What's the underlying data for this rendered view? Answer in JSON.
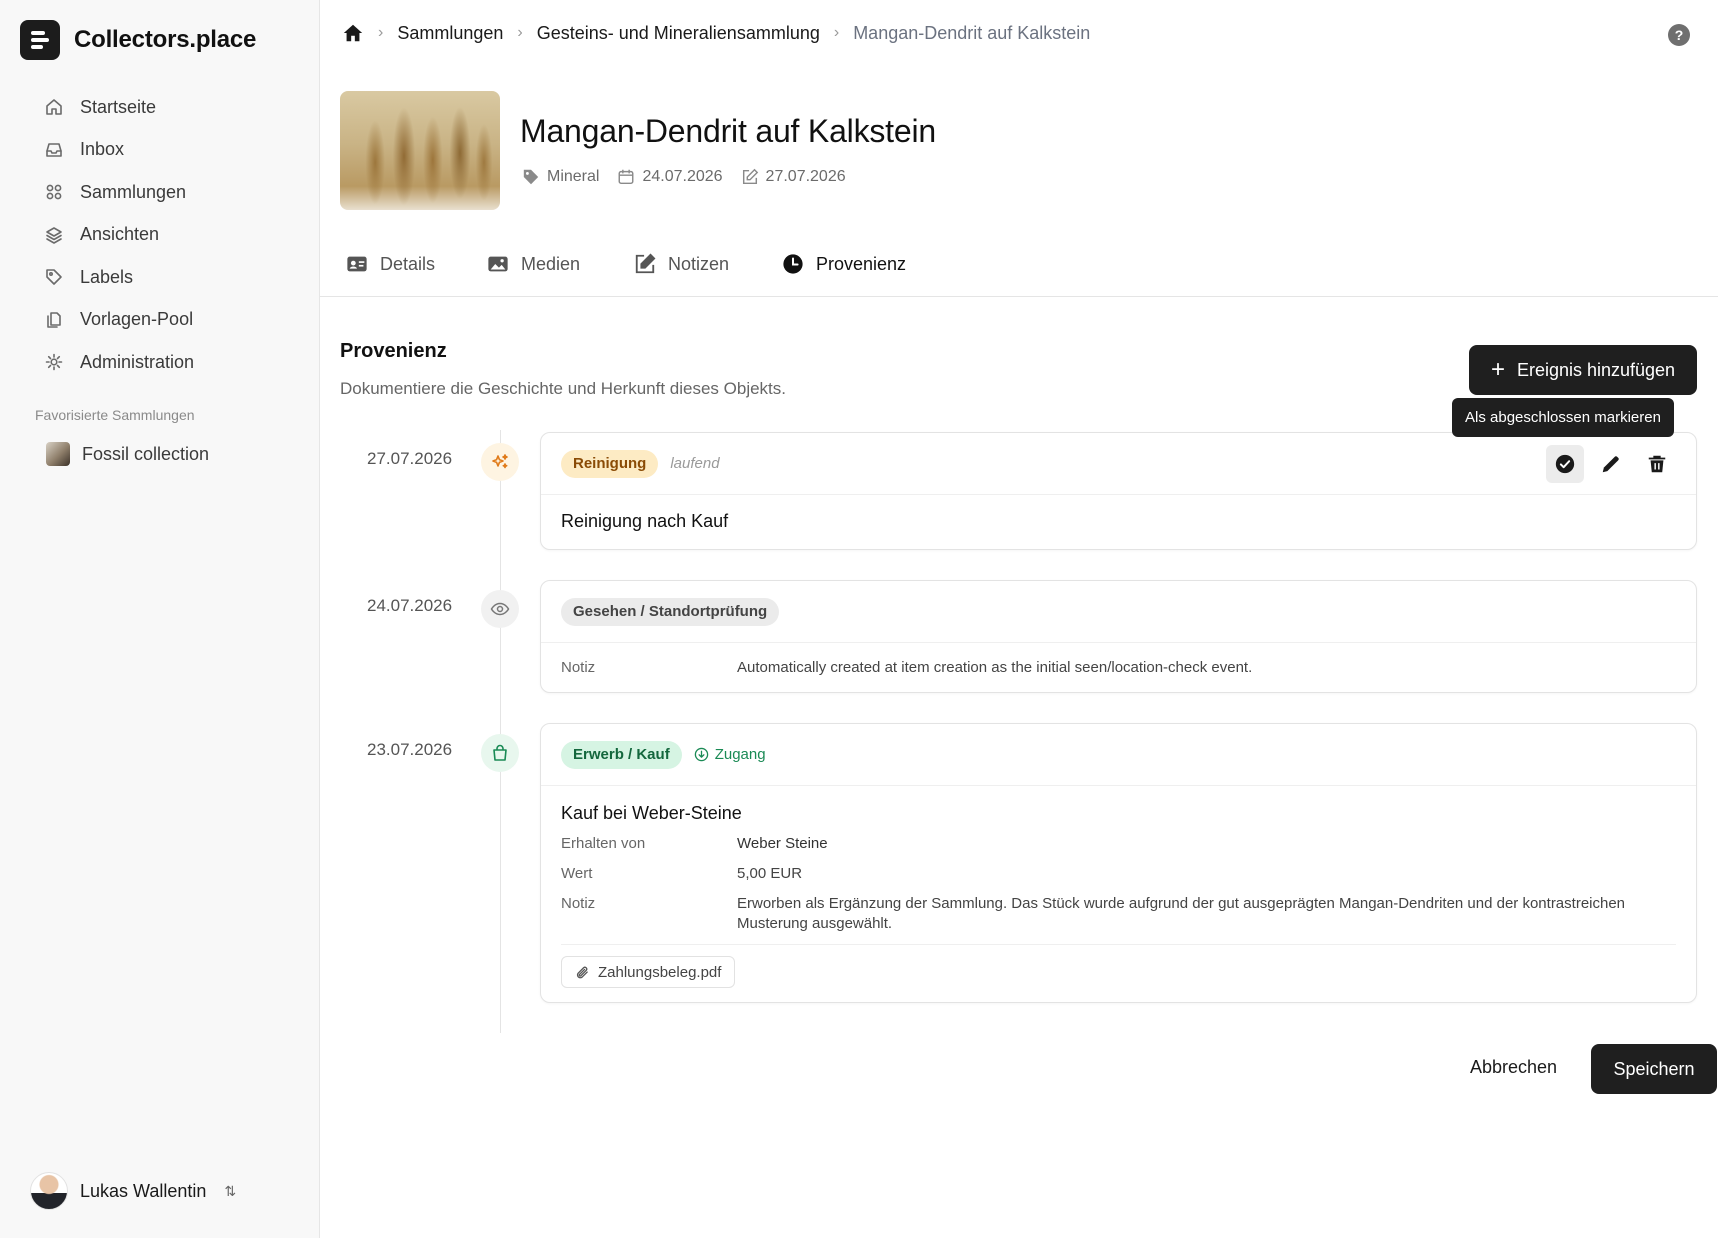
{
  "app": {
    "name": "Collectors.place"
  },
  "sidebar": {
    "items": [
      {
        "label": "Startseite",
        "icon": "home-icon"
      },
      {
        "label": "Inbox",
        "icon": "inbox-icon"
      },
      {
        "label": "Sammlungen",
        "icon": "grid-icon"
      },
      {
        "label": "Ansichten",
        "icon": "layers-icon"
      },
      {
        "label": "Labels",
        "icon": "tag-icon"
      },
      {
        "label": "Vorlagen-Pool",
        "icon": "copy-icon"
      },
      {
        "label": "Administration",
        "icon": "gear-icon"
      }
    ],
    "favorites_label": "Favorisierte Sammlungen",
    "favorites": [
      {
        "label": "Fossil collection"
      }
    ],
    "user": {
      "name": "Lukas Wallentin"
    }
  },
  "breadcrumb": {
    "items": [
      "Sammlungen",
      "Gesteins- und Mineraliensammlung"
    ],
    "current": "Mangan-Dendrit auf Kalkstein"
  },
  "item": {
    "title": "Mangan-Dendrit auf Kalkstein",
    "type": "Mineral",
    "created": "24.07.2026",
    "edited": "27.07.2026"
  },
  "tabs": [
    {
      "label": "Details",
      "icon": "id-card-icon"
    },
    {
      "label": "Medien",
      "icon": "image-icon"
    },
    {
      "label": "Notizen",
      "icon": "edit-icon"
    },
    {
      "label": "Provenienz",
      "icon": "clock-icon",
      "active": true
    }
  ],
  "provenance": {
    "title": "Provenienz",
    "subtitle": "Dokumentiere die Geschichte und Herkunft dieses Objekts.",
    "add_label": "Ereignis hinzufügen",
    "tooltip": "Als abgeschlossen markieren",
    "events": [
      {
        "date": "27.07.2026",
        "type": "Reinigung",
        "status": "laufend",
        "text": "Reinigung nach Kauf",
        "colors": {
          "badge_bg": "#fdebc4",
          "badge_fg": "#8a4b06",
          "dot_bg": "#fef4e2"
        }
      },
      {
        "date": "24.07.2026",
        "type": "Gesehen / Standortprüfung",
        "note_label": "Notiz",
        "note": "Automatically created at item creation as the initial seen/location-check event."
      },
      {
        "date": "23.07.2026",
        "type": "Erwerb / Kauf",
        "direction": "Zugang",
        "text": "Kauf bei Weber-Steine",
        "fields": [
          {
            "label": "Erhalten von",
            "value": "Weber Steine"
          },
          {
            "label": "Wert",
            "value": "5,00 EUR"
          },
          {
            "label": "Notiz",
            "value": "Erworben als Ergänzung der Sammlung. Das Stück wurde aufgrund der gut ausgeprägten Mangan-Dendriten und der kontrastreichen Musterung ausgewählt."
          }
        ],
        "attachment": "Zahlungsbeleg.pdf"
      }
    ]
  },
  "footer": {
    "cancel_label": "Abbrechen",
    "save_label": "Speichern"
  },
  "colors": {
    "primary": "#1f1f1f",
    "success": "#1a8a55",
    "warning": "#e07b1a"
  }
}
